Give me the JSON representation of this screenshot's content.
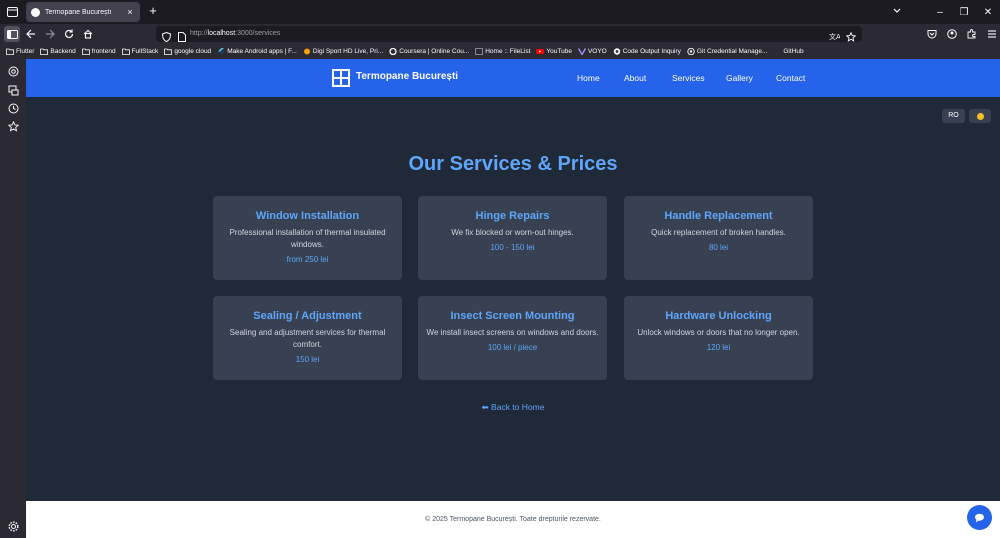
{
  "browser": {
    "tab_title": "Termopane București",
    "tab_close": "×",
    "new_tab": "+",
    "url_prefix": "http://",
    "url_host": "localhost",
    "url_rest": ":3000/services",
    "window_controls": [
      "–",
      "❐",
      "✕"
    ]
  },
  "bookmarks": [
    {
      "label": "Flutter",
      "icon": "folder-icon"
    },
    {
      "label": "Backend",
      "icon": "folder-icon"
    },
    {
      "label": "frontend",
      "icon": "folder-icon"
    },
    {
      "label": "FullStack",
      "icon": "folder-icon"
    },
    {
      "label": "google cloud",
      "icon": "folder-icon"
    },
    {
      "label": "Make Android apps | F...",
      "icon": "flutter-icon"
    },
    {
      "label": "Digi Sport HD Live, Pri...",
      "icon": "digi-icon"
    },
    {
      "label": "Coursera | Online Cou...",
      "icon": "coursera-icon"
    },
    {
      "label": "Home :: FileList",
      "icon": "filelist-icon"
    },
    {
      "label": "YouTube",
      "icon": "youtube-icon"
    },
    {
      "label": "VOYO",
      "icon": "voyo-icon"
    },
    {
      "label": "Code Output Inquiry",
      "icon": "chatgpt-icon"
    },
    {
      "label": "Git Credential Manage...",
      "icon": "github-icon"
    },
    {
      "label": "GitHub",
      "icon": "none"
    }
  ],
  "site": {
    "brand": "Termopane București",
    "menu": [
      "Home",
      "About",
      "Services",
      "Gallery",
      "Contact"
    ],
    "lang_button": "RO",
    "title": "Our Services & Prices",
    "services": [
      {
        "title": "Window Installation",
        "description": "Professional installation of thermal insulated windows.",
        "price": "from 250 lei"
      },
      {
        "title": "Hinge Repairs",
        "description": "We fix blocked or worn-out hinges.",
        "price": "100 - 150 lei"
      },
      {
        "title": "Handle Replacement",
        "description": "Quick replacement of broken handles.",
        "price": "80 lei"
      },
      {
        "title": "Sealing / Adjustment",
        "description": "Sealing and adjustment services for thermal comfort.",
        "price": "150 lei"
      },
      {
        "title": "Insect Screen Mounting",
        "description": "We install insect screens on windows and doors.",
        "price": "100 lei / piece"
      },
      {
        "title": "Hardware Unlocking",
        "description": "Unlock windows or doors that no longer open.",
        "price": "120 lei"
      }
    ],
    "back_link": "⬅ Back to Home",
    "footer": "© 2025 Termopane București. Toate drepturile rezervate."
  },
  "colors": {
    "header_blue": "#2563eb",
    "accent_blue": "#60a5fa",
    "page_bg": "#1f2937",
    "card_bg": "#374151"
  }
}
